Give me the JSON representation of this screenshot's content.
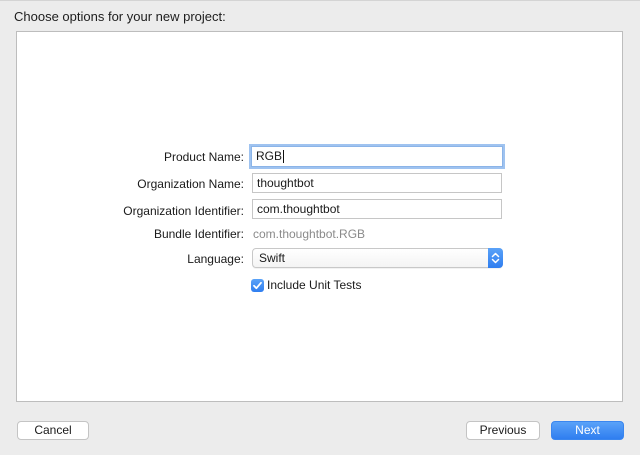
{
  "header": {
    "title": "Choose options for your new project:"
  },
  "form": {
    "product_name": {
      "label": "Product Name:",
      "value": "RGB"
    },
    "organization_name": {
      "label": "Organization Name:",
      "value": "thoughtbot"
    },
    "organization_identifier": {
      "label": "Organization Identifier:",
      "value": "com.thoughtbot"
    },
    "bundle_identifier": {
      "label": "Bundle Identifier:",
      "value": "com.thoughtbot.RGB"
    },
    "language": {
      "label": "Language:",
      "selected": "Swift"
    },
    "include_unit_tests": {
      "label": "Include Unit Tests",
      "checked": true
    }
  },
  "footer": {
    "cancel_label": "Cancel",
    "previous_label": "Previous",
    "next_label": "Next"
  },
  "colors": {
    "accent": "#2f7ef0",
    "focus_ring": "#9fc3f0",
    "panel_background": "#ffffff",
    "window_background": "#ececec"
  },
  "icons": {
    "popup_arrows": "chevron-updown-icon",
    "checkbox_check": "checkmark-icon"
  }
}
